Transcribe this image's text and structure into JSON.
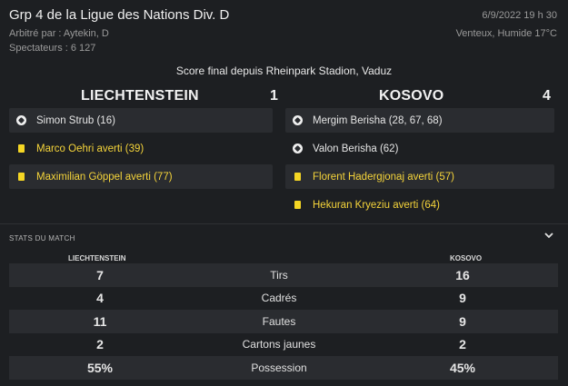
{
  "header": {
    "title": "Grp 4 de la Ligue des Nations Div. D",
    "referee": "Arbitré par : Aytekin, D",
    "attendance": "Spectateurs : 6 127",
    "datetime": "6/9/2022 19 h 30",
    "weather": "Venteux, Humide 17°C"
  },
  "result": {
    "heading": "Score final depuis Rheinpark Stadion, Vaduz",
    "home": {
      "name": "LIECHTENSTEIN",
      "score": "1"
    },
    "away": {
      "name": "KOSOVO",
      "score": "4"
    }
  },
  "events": {
    "home": [
      {
        "type": "goal",
        "text": "Simon Strub (16)",
        "icon": "ball-icon"
      },
      {
        "type": "card",
        "text": "Marco Oehri averti (39)",
        "icon": "yellow-card-icon"
      },
      {
        "type": "card",
        "text": "Maximilian Göppel averti (77)",
        "icon": "yellow-card-icon"
      }
    ],
    "away": [
      {
        "type": "goal",
        "text": "Mergim Berisha (28, 67, 68)",
        "icon": "ball-icon"
      },
      {
        "type": "goal",
        "text": "Valon Berisha (62)",
        "icon": "ball-icon"
      },
      {
        "type": "card",
        "text": "Florent Hadergjonaj averti (57)",
        "icon": "yellow-card-icon"
      },
      {
        "type": "card",
        "text": "Hekuran Kryeziu averti (64)",
        "icon": "yellow-card-icon"
      }
    ]
  },
  "stats": {
    "section_title": "STATS DU MATCH",
    "home_header": "LIECHTENSTEIN",
    "away_header": "KOSOVO",
    "rows": [
      {
        "label": "Tirs",
        "home": "7",
        "away": "16"
      },
      {
        "label": "Cadrés",
        "home": "4",
        "away": "9"
      },
      {
        "label": "Fautes",
        "home": "11",
        "away": "9"
      },
      {
        "label": "Cartons jaunes",
        "home": "2",
        "away": "2"
      },
      {
        "label": "Possession",
        "home": "55%",
        "away": "45%"
      }
    ]
  },
  "colors": {
    "background": "#1d1f22",
    "row": "#2a2c30",
    "card_text": "#f5d43a",
    "card": "#f5d624"
  }
}
